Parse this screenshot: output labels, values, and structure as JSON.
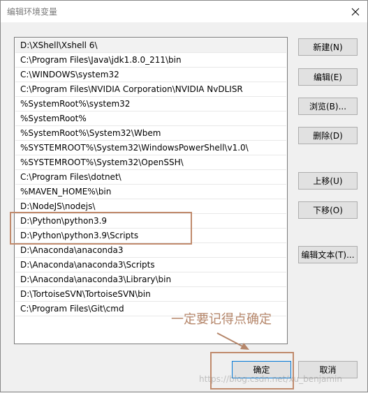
{
  "window": {
    "title": "编辑环境变量"
  },
  "icons": {
    "close": "close-icon"
  },
  "paths": [
    "D:\\XShell\\Xshell 6\\",
    "C:\\Program Files\\Java\\jdk1.8.0_211\\bin",
    "C:\\WINDOWS\\system32",
    "C:\\Program Files\\NVIDIA Corporation\\NVIDIA NvDLISR",
    "%SystemRoot%\\system32",
    "%SystemRoot%",
    "%SystemRoot%\\System32\\Wbem",
    "%SYSTEMROOT%\\System32\\WindowsPowerShell\\v1.0\\",
    "%SYSTEMROOT%\\System32\\OpenSSH\\",
    "C:\\Program Files\\dotnet\\",
    "%MAVEN_HOME%\\bin",
    "D:\\NodeJS\\nodejs\\",
    "D:\\Python\\python3.9",
    "D:\\Python\\python3.9\\Scripts",
    "D:\\Anaconda\\anaconda3",
    "D:\\Anaconda\\anaconda3\\Scripts",
    "D:\\Anaconda\\anaconda3\\Library\\bin",
    "D:\\TortoiseSVN\\TortoiseSVN\\bin",
    "C:\\Program Files\\Git\\cmd"
  ],
  "selected_index": 0,
  "buttons": {
    "new": "新建(N)",
    "edit": "编辑(E)",
    "browse": "浏览(B)...",
    "delete": "删除(D)",
    "move_up": "上移(U)",
    "move_down": "下移(O)",
    "edit_text": "编辑文本(T)...",
    "ok": "确定",
    "cancel": "取消"
  },
  "annotation": {
    "text": "一定要记得点确定"
  },
  "watermark": "https://blog.csdn.net/xu_benjamin",
  "colors": {
    "annotation": "#c08a6c",
    "default_button_border": "#0078d7"
  }
}
